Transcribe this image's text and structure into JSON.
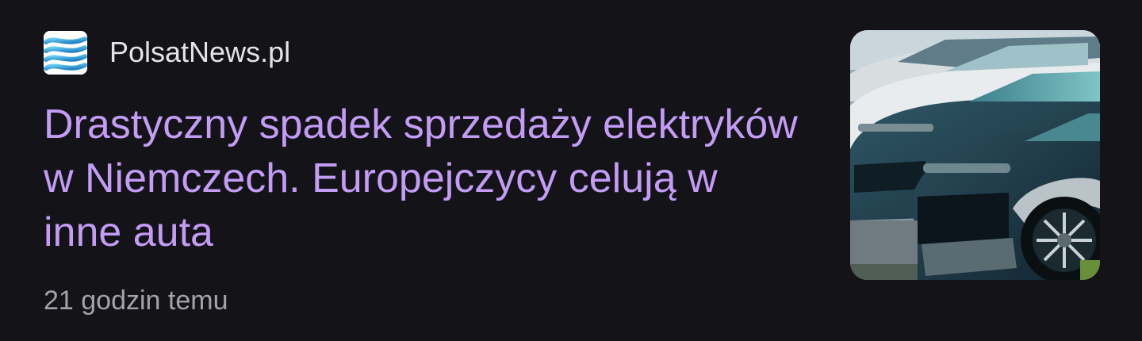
{
  "source": {
    "name": "PolsatNews.pl",
    "logo_icon": "polsat-news-logo-icon"
  },
  "article": {
    "headline": "Drastyczny spadek sprzedaży elektryków w Niemczech. Europejczycy celują w inne auta",
    "published": "21 godzin temu",
    "thumbnail_icon": "parked-electric-cars-image"
  },
  "colors": {
    "background": "#131318",
    "headline": "#c39cf5",
    "source_text": "#e3e3e8",
    "meta_text": "#a3a3ab"
  }
}
